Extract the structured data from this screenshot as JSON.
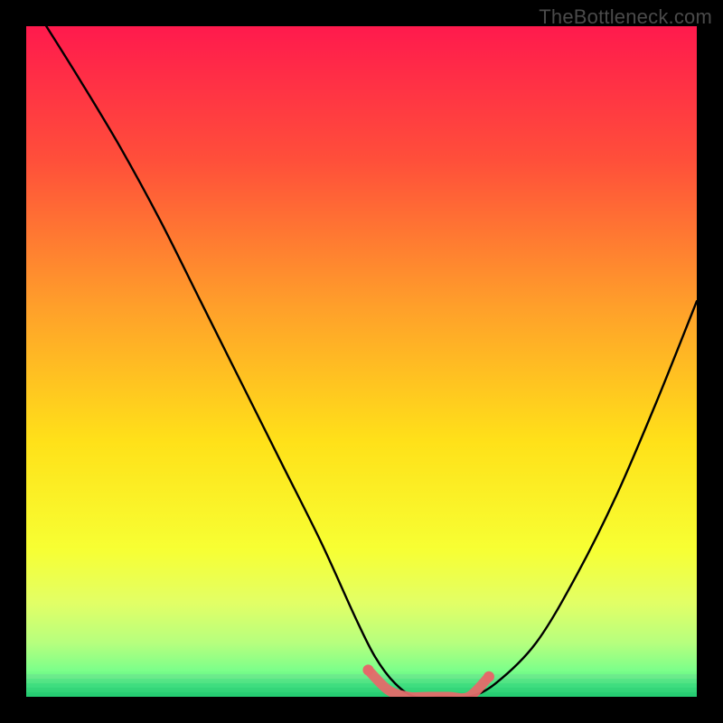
{
  "watermark": "TheBottleneck.com",
  "colors": {
    "frame": "#000000",
    "curve": "#000000",
    "accent": "#e46a6a",
    "gradient_stops": [
      {
        "offset": 0.0,
        "color": "#ff1a4d"
      },
      {
        "offset": 0.2,
        "color": "#ff4f3a"
      },
      {
        "offset": 0.42,
        "color": "#ffa02a"
      },
      {
        "offset": 0.62,
        "color": "#ffe119"
      },
      {
        "offset": 0.78,
        "color": "#f7ff33"
      },
      {
        "offset": 0.86,
        "color": "#e2ff66"
      },
      {
        "offset": 0.92,
        "color": "#b6ff7e"
      },
      {
        "offset": 0.96,
        "color": "#7dff8a"
      },
      {
        "offset": 1.0,
        "color": "#29e27a"
      }
    ]
  },
  "chart_data": {
    "type": "line",
    "title": "",
    "xlabel": "",
    "ylabel": "",
    "xlim": [
      0,
      100
    ],
    "ylim": [
      0,
      100
    ],
    "series": [
      {
        "name": "bottleneck-curve",
        "x": [
          3,
          8,
          14,
          20,
          26,
          32,
          38,
          44,
          49,
          52,
          55,
          58,
          62,
          66,
          70,
          76,
          82,
          88,
          94,
          100
        ],
        "values": [
          100,
          92,
          82,
          71,
          59,
          47,
          35,
          23,
          12,
          6,
          2,
          0,
          0,
          0,
          2,
          8,
          18,
          30,
          44,
          59
        ]
      }
    ],
    "accent_segment": {
      "name": "valley-highlight",
      "x": [
        51,
        54,
        57,
        60,
        63,
        66,
        69
      ],
      "values": [
        4,
        1,
        0,
        0,
        0,
        0,
        3
      ]
    },
    "annotations": []
  }
}
